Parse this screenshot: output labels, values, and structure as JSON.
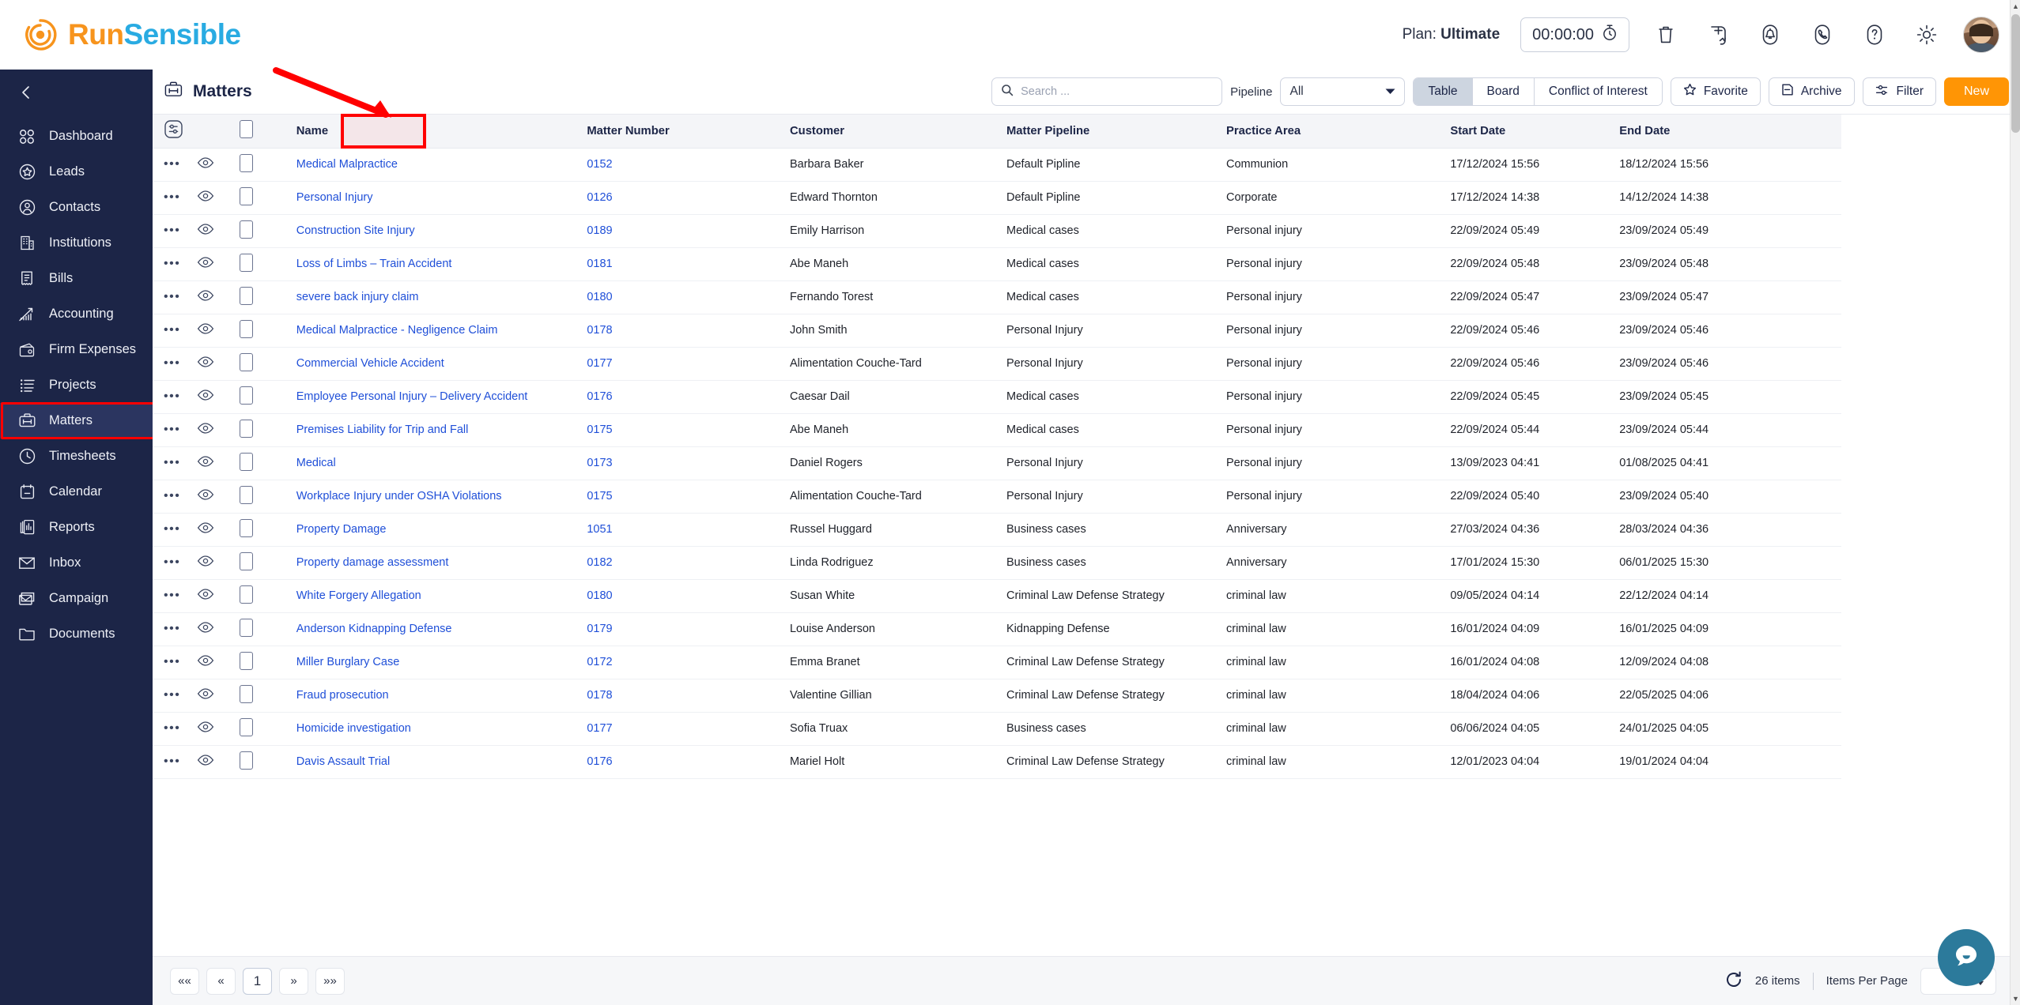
{
  "brand": {
    "run": "Run",
    "sensible": "Sensible",
    "accent_orange": "#F7941D",
    "accent_blue": "#29ABE2"
  },
  "topbar": {
    "plan_prefix": "Plan:",
    "plan_value": "Ultimate",
    "timer": "00:00:00",
    "icons": [
      "trash-icon",
      "add-circle-icon",
      "notification-bell-icon",
      "phone-icon",
      "help-icon",
      "settings-gear-icon"
    ]
  },
  "sidebar": {
    "collapse_label": "collapse-sidebar",
    "items": [
      {
        "label": "Dashboard",
        "icon": "dashboard-icon"
      },
      {
        "label": "Leads",
        "icon": "leads-star-icon"
      },
      {
        "label": "Contacts",
        "icon": "contacts-person-icon"
      },
      {
        "label": "Institutions",
        "icon": "institutions-building-icon"
      },
      {
        "label": "Bills",
        "icon": "bills-receipt-icon"
      },
      {
        "label": "Accounting",
        "icon": "accounting-chart-icon"
      },
      {
        "label": "Firm Expenses",
        "icon": "firm-expenses-wallet-icon"
      },
      {
        "label": "Projects",
        "icon": "projects-list-icon"
      },
      {
        "label": "Matters",
        "icon": "matters-briefcase-icon"
      },
      {
        "label": "Timesheets",
        "icon": "timesheets-clock-icon"
      },
      {
        "label": "Calendar",
        "icon": "calendar-icon"
      },
      {
        "label": "Reports",
        "icon": "reports-icon"
      },
      {
        "label": "Inbox",
        "icon": "inbox-envelope-icon"
      },
      {
        "label": "Campaign",
        "icon": "campaign-mail-icon"
      },
      {
        "label": "Documents",
        "icon": "documents-folder-icon"
      }
    ],
    "active_index": 8
  },
  "page": {
    "title": "Matters",
    "title_icon": "matters-briefcase-icon"
  },
  "toolbar": {
    "search_placeholder": "Search ...",
    "pipeline_label": "Pipeline",
    "pipeline_value": "All",
    "view_tabs": [
      {
        "label": "Table",
        "selected": true
      },
      {
        "label": "Board",
        "selected": false
      },
      {
        "label": "Conflict of Interest",
        "selected": false
      }
    ],
    "favorite_label": "Favorite",
    "archive_label": "Archive",
    "filter_label": "Filter",
    "new_label": "New"
  },
  "table": {
    "columns": [
      "Name",
      "Matter Number",
      "Customer",
      "Matter Pipeline",
      "Practice Area",
      "Start Date",
      "End Date"
    ],
    "rows": [
      {
        "name": "Medical Malpractice",
        "number": "0152",
        "customer": "Barbara Baker",
        "pipeline": "Default Pipline",
        "practice_area": "Communion",
        "start_date": "17/12/2024 15:56",
        "end_date": "18/12/2024 15:56"
      },
      {
        "name": "Personal Injury",
        "number": "0126",
        "customer": "Edward Thornton",
        "pipeline": "Default Pipline",
        "practice_area": "Corporate",
        "start_date": "17/12/2024 14:38",
        "end_date": "14/12/2024 14:38"
      },
      {
        "name": "Construction Site Injury",
        "number": "0189",
        "customer": "Emily Harrison",
        "pipeline": "Medical cases",
        "practice_area": "Personal injury",
        "start_date": "22/09/2024 05:49",
        "end_date": "23/09/2024 05:49"
      },
      {
        "name": "Loss of Limbs – Train Accident",
        "number": "0181",
        "customer": "Abe Maneh",
        "pipeline": "Medical cases",
        "practice_area": "Personal injury",
        "start_date": "22/09/2024 05:48",
        "end_date": "23/09/2024 05:48"
      },
      {
        "name": "severe back injury claim",
        "number": "0180",
        "customer": "Fernando Torest",
        "pipeline": "Medical cases",
        "practice_area": "Personal injury",
        "start_date": "22/09/2024 05:47",
        "end_date": "23/09/2024 05:47"
      },
      {
        "name": "Medical Malpractice - Negligence Claim",
        "number": "0178",
        "customer": "John Smith",
        "pipeline": "Personal Injury",
        "practice_area": "Personal injury",
        "start_date": "22/09/2024 05:46",
        "end_date": "23/09/2024 05:46"
      },
      {
        "name": "Commercial Vehicle Accident",
        "number": "0177",
        "customer": "Alimentation Couche-Tard",
        "pipeline": "Personal Injury",
        "practice_area": "Personal injury",
        "start_date": "22/09/2024 05:46",
        "end_date": "23/09/2024 05:46"
      },
      {
        "name": "Employee Personal Injury – Delivery Accident",
        "number": "0176",
        "customer": "Caesar Dail",
        "pipeline": "Medical cases",
        "practice_area": "Personal injury",
        "start_date": "22/09/2024 05:45",
        "end_date": "23/09/2024 05:45"
      },
      {
        "name": "Premises Liability for Trip and Fall",
        "number": "0175",
        "customer": "Abe Maneh",
        "pipeline": "Medical cases",
        "practice_area": "Personal injury",
        "start_date": "22/09/2024 05:44",
        "end_date": "23/09/2024 05:44"
      },
      {
        "name": "Medical",
        "number": "0173",
        "customer": "Daniel Rogers",
        "pipeline": "Personal Injury",
        "practice_area": "Personal injury",
        "start_date": "13/09/2023 04:41",
        "end_date": "01/08/2025 04:41"
      },
      {
        "name": "Workplace Injury under OSHA Violations",
        "number": "0175",
        "customer": "Alimentation Couche-Tard",
        "pipeline": "Personal Injury",
        "practice_area": "Personal injury",
        "start_date": "22/09/2024 05:40",
        "end_date": "23/09/2024 05:40"
      },
      {
        "name": "Property Damage",
        "number": "1051",
        "customer": "Russel Huggard",
        "pipeline": "Business cases",
        "practice_area": "Anniversary",
        "start_date": "27/03/2024 04:36",
        "end_date": "28/03/2024 04:36"
      },
      {
        "name": "Property damage assessment",
        "number": "0182",
        "customer": "Linda Rodriguez",
        "pipeline": "Business cases",
        "practice_area": "Anniversary",
        "start_date": "17/01/2024 15:30",
        "end_date": "06/01/2025 15:30"
      },
      {
        "name": "White Forgery Allegation",
        "number": "0180",
        "customer": "Susan White",
        "pipeline": "Criminal Law Defense Strategy",
        "practice_area": "criminal law",
        "start_date": "09/05/2024 04:14",
        "end_date": "22/12/2024 04:14"
      },
      {
        "name": "Anderson Kidnapping Defense",
        "number": "0179",
        "customer": "Louise Anderson",
        "pipeline": "Kidnapping Defense",
        "practice_area": "criminal law",
        "start_date": "16/01/2024 04:09",
        "end_date": "16/01/2025 04:09"
      },
      {
        "name": "Miller Burglary Case",
        "number": "0172",
        "customer": "Emma Branet",
        "pipeline": "Criminal Law Defense Strategy",
        "practice_area": "criminal law",
        "start_date": "16/01/2024 04:08",
        "end_date": "12/09/2024 04:08"
      },
      {
        "name": "Fraud prosecution",
        "number": "0178",
        "customer": "Valentine Gillian",
        "pipeline": "Criminal Law Defense Strategy",
        "practice_area": "criminal law",
        "start_date": "18/04/2024 04:06",
        "end_date": "22/05/2025 04:06"
      },
      {
        "name": "Homicide investigation",
        "number": "0177",
        "customer": "Sofia Truax",
        "pipeline": "Business cases",
        "practice_area": "criminal law",
        "start_date": "06/06/2024 04:05",
        "end_date": "24/01/2025 04:05"
      },
      {
        "name": "Davis Assault Trial",
        "number": "0176",
        "customer": "Mariel Holt",
        "pipeline": "Criminal Law Defense Strategy",
        "practice_area": "criminal law",
        "start_date": "12/01/2023 04:04",
        "end_date": "19/01/2024 04:04"
      }
    ]
  },
  "footer": {
    "first_label": "««",
    "prev_label": "«",
    "current_page": "1",
    "next_label": "»",
    "last_label": "»»",
    "item_count": "26 items",
    "items_per_page_label": "Items Per Page",
    "refresh_icon": "refresh-icon"
  },
  "annotations": {
    "highlight_color": "#FF0000",
    "arrow_target": "Matter Number",
    "boxed_sidebar_item": "Matters"
  },
  "chat": {
    "icon": "chat-bubble-icon",
    "color": "#2C7A9B"
  }
}
